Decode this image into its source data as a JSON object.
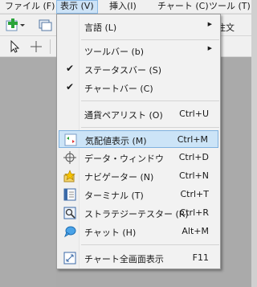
{
  "menubar": {
    "items": [
      {
        "label": "ファイル (F)"
      },
      {
        "label": "表示 (V)"
      },
      {
        "label": "挿入(I)"
      },
      {
        "label": "チャート (C)"
      },
      {
        "label": "ツール (T)"
      }
    ]
  },
  "toolbar": {
    "new_order_label": "規注文"
  },
  "view_menu": {
    "items": [
      {
        "label": "言語 (L)",
        "submenu": true
      },
      {
        "label": "ツールバー (b)",
        "submenu": true
      },
      {
        "label": "ステータスバー (S)",
        "checked": true
      },
      {
        "label": "チャートバー (C)",
        "checked": true
      },
      {
        "label": "通貨ペアリスト (O)",
        "shortcut": "Ctrl+U"
      },
      {
        "label": "気配値表示 (M)",
        "shortcut": "Ctrl+M",
        "highlighted": true
      },
      {
        "label": "データ・ウィンドウ",
        "shortcut": "Ctrl+D"
      },
      {
        "label": "ナビゲーター (N)",
        "shortcut": "Ctrl+N"
      },
      {
        "label": "ターミナル (T)",
        "shortcut": "Ctrl+T"
      },
      {
        "label": "ストラテジーテスター (R)",
        "shortcut": "Ctrl+R"
      },
      {
        "label": "チャット (H)",
        "shortcut": "Alt+M"
      },
      {
        "label": "チャート全画面表示",
        "shortcut": "F11"
      }
    ]
  },
  "colors": {
    "highlight": "#cce4f7",
    "highlight_border": "#7fb1df",
    "workspace": "#aaaaaa"
  }
}
